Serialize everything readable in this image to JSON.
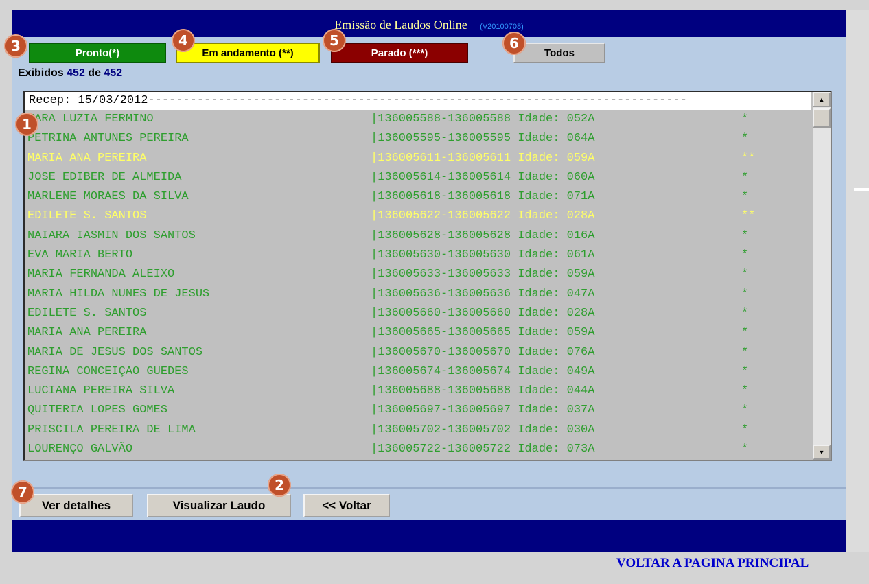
{
  "window": {
    "title": "Emissão de Laudos Online",
    "version": "(V20100708)"
  },
  "filters": {
    "pronto": "Pronto(*)",
    "andamento": "Em andamento (**)",
    "parado": "Parado (***)",
    "todos": "Todos"
  },
  "count": {
    "label": "Exibidos",
    "shown": "452",
    "of": "de",
    "total": "452"
  },
  "list": {
    "header": "Recep: 15/03/2012-----------------------------------------------------------------------------",
    "rows": [
      {
        "name": "MARA LUZIA FERMINO",
        "code": "|136005588-136005588 Idade: 052A",
        "stars": "*",
        "status": "green"
      },
      {
        "name": "PETRINA ANTUNES PEREIRA",
        "code": "|136005595-136005595 Idade: 064A",
        "stars": "*",
        "status": "green"
      },
      {
        "name": "MARIA ANA PEREIRA",
        "code": "|136005611-136005611 Idade: 059A",
        "stars": "**",
        "status": "yellow"
      },
      {
        "name": "JOSE EDIBER DE ALMEIDA",
        "code": "|136005614-136005614 Idade: 060A",
        "stars": "*",
        "status": "green"
      },
      {
        "name": "MARLENE MORAES DA SILVA",
        "code": "|136005618-136005618 Idade: 071A",
        "stars": "*",
        "status": "green"
      },
      {
        "name": "EDILETE S. SANTOS",
        "code": "|136005622-136005622 Idade: 028A",
        "stars": "**",
        "status": "yellow"
      },
      {
        "name": "NAIARA IASMIN DOS SANTOS",
        "code": "|136005628-136005628 Idade: 016A",
        "stars": "*",
        "status": "green"
      },
      {
        "name": "EVA MARIA BERTO",
        "code": "|136005630-136005630 Idade: 061A",
        "stars": "*",
        "status": "green"
      },
      {
        "name": "MARIA FERNANDA ALEIXO",
        "code": "|136005633-136005633 Idade: 059A",
        "stars": "*",
        "status": "green"
      },
      {
        "name": "MARIA HILDA NUNES DE JESUS",
        "code": "|136005636-136005636 Idade: 047A",
        "stars": "*",
        "status": "green"
      },
      {
        "name": "EDILETE S. SANTOS",
        "code": "|136005660-136005660 Idade: 028A",
        "stars": "*",
        "status": "green"
      },
      {
        "name": "MARIA ANA PEREIRA",
        "code": "|136005665-136005665 Idade: 059A",
        "stars": "*",
        "status": "green"
      },
      {
        "name": "MARIA DE JESUS DOS SANTOS",
        "code": "|136005670-136005670 Idade: 076A",
        "stars": "*",
        "status": "green"
      },
      {
        "name": "REGINA CONCEIÇAO GUEDES",
        "code": "|136005674-136005674 Idade: 049A",
        "stars": "*",
        "status": "green"
      },
      {
        "name": "LUCIANA PEREIRA SILVA",
        "code": "|136005688-136005688 Idade: 044A",
        "stars": "*",
        "status": "green"
      },
      {
        "name": "QUITERIA LOPES GOMES",
        "code": "|136005697-136005697 Idade: 037A",
        "stars": "*",
        "status": "green"
      },
      {
        "name": "PRISCILA PEREIRA DE LIMA",
        "code": "|136005702-136005702 Idade: 030A",
        "stars": "*",
        "status": "green"
      },
      {
        "name": "LOURENÇO GALVÃO",
        "code": "|136005722-136005722 Idade: 073A",
        "stars": "*",
        "status": "green"
      }
    ]
  },
  "actions": {
    "detalhes": "Ver detalhes",
    "visualizar": "Visualizar Laudo",
    "voltar": "<< Voltar"
  },
  "footer": {
    "link": "VOLTAR A PAGINA PRINCIPAL"
  },
  "badges": {
    "b1": "1",
    "b2": "2",
    "b3": "3",
    "b4": "4",
    "b5": "5",
    "b6": "6",
    "b7": "7"
  },
  "colors": {
    "titlebar": "#000080",
    "panel": "#b8cce4",
    "pronto": "#0e8a0e",
    "andamento": "#ffff00",
    "parado": "#8b0000",
    "row_green": "#2e9e2e",
    "row_yellow": "#ffff66",
    "badge": "#c0502a"
  }
}
